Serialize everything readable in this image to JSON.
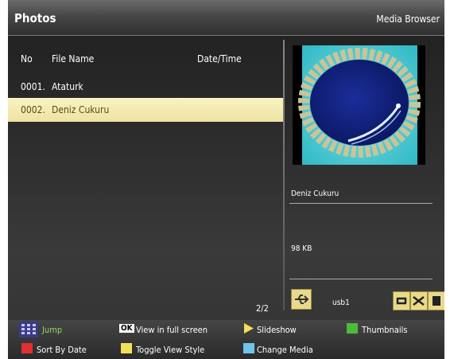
{
  "header": {
    "title": "Photos",
    "app_name": "Media Browser"
  },
  "list": {
    "columns": {
      "no": "No",
      "file_name": "File Name",
      "date_time": "Date/Time"
    },
    "rows": [
      {
        "no": "0001.",
        "name": "Ataturk",
        "selected": false
      },
      {
        "no": "0002.",
        "name": "Deniz Cukuru",
        "selected": true
      }
    ],
    "page": "2/2"
  },
  "preview": {
    "image_icon": "photo-thumbnail",
    "name": "Deniz Cukuru",
    "size": "98 KB",
    "device": "usb1",
    "device_icon": "usb-icon",
    "controls": [
      "repeat-icon",
      "shuffle-icon",
      "stop-icon"
    ]
  },
  "legend": {
    "jump": "Jump",
    "ok_key": "OK",
    "view_full": "View in full screen",
    "slideshow": "Slideshow",
    "thumbnails": "Thumbnails",
    "sort_by_date": "Sort By Date",
    "toggle_view": "Toggle View Style",
    "change_media": "Change Media"
  },
  "colors": {
    "selected_row": "#f4edb2",
    "red_key": "#e03030",
    "green_key": "#4dbb3a",
    "yellow_key": "#f1e05a",
    "blue_key": "#6fc5e6"
  }
}
